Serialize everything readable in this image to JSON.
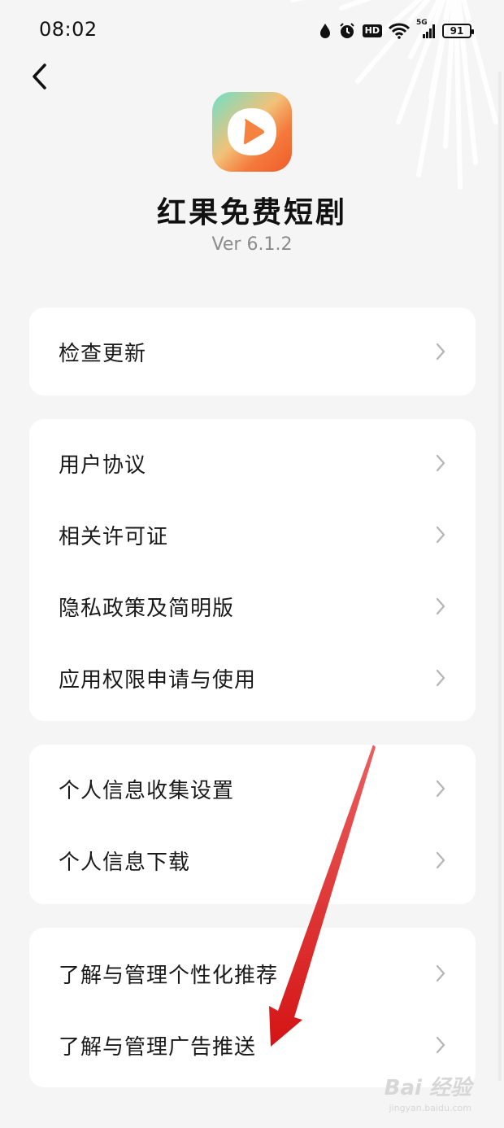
{
  "status_bar": {
    "time": "08:02",
    "icons": [
      "drop-icon",
      "alarm-icon",
      "hd-icon",
      "wifi-icon",
      "5g-signal-icon",
      "battery-icon"
    ],
    "hd_label": "HD",
    "network_label": "5G",
    "battery_level": "91"
  },
  "header": {
    "back_icon": "chevron-left-icon",
    "app_name": "红果免费短剧",
    "version": "Ver 6.1.2",
    "icon_colors": [
      "#6ee0c8",
      "#f2c178",
      "#f15b2a"
    ]
  },
  "groups": [
    {
      "items": [
        {
          "label": "检查更新"
        }
      ]
    },
    {
      "items": [
        {
          "label": "用户协议"
        },
        {
          "label": "相关许可证"
        },
        {
          "label": "隐私政策及简明版"
        },
        {
          "label": "应用权限申请与使用"
        }
      ]
    },
    {
      "items": [
        {
          "label": "个人信息收集设置"
        },
        {
          "label": "个人信息下载"
        }
      ]
    },
    {
      "items": [
        {
          "label": "了解与管理个性化推荐"
        },
        {
          "label": "了解与管理广告推送"
        }
      ]
    }
  ],
  "annotation": {
    "type": "red-arrow",
    "color": "#e01b1b",
    "points_to": "了解与管理广告推送"
  },
  "watermark": {
    "main": "Bai 经验",
    "sub": "jingyan.baidu.com"
  },
  "colors": {
    "background": "#f5f5f5",
    "card": "#ffffff",
    "chevron": "#b5b5b5",
    "version_text": "#8c8c8c"
  }
}
